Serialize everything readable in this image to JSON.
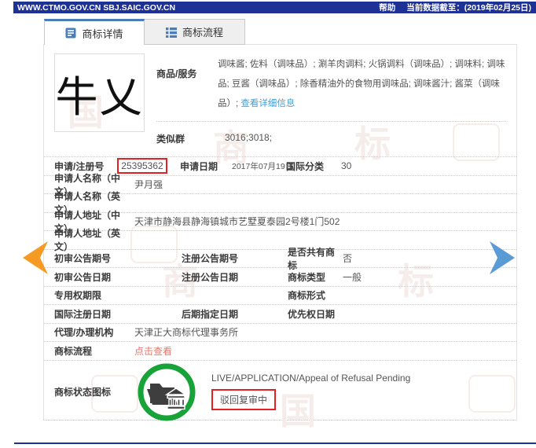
{
  "topbar": {
    "urls": "WWW.CTMO.GOV.CN SBJ.SAIC.GOV.CN",
    "help": "帮助",
    "cutoff": "当前数据截至：(2019年02月25日)"
  },
  "tabs": {
    "detail": "商标详情",
    "process": "商标流程"
  },
  "mark": {
    "text": "牛乂"
  },
  "goods": {
    "label": "商品/服务",
    "text": "调味酱; 佐料（调味品）; 涮羊肉调料; 火锅调料（调味品）; 调味料; 调味品; 豆酱（调味品）; 除香精油外的食物用调味品; 调味酱汁; 酱菜（调味品）; ",
    "link": "查看详细信息"
  },
  "similar": {
    "label": "类似群",
    "value": "3016;3018;"
  },
  "app_row": {
    "reg_label": "申请/注册号",
    "reg_value": "25395362",
    "date_label": "申请日期",
    "date_value": "2017年07月19日",
    "class_label": "国际分类",
    "class_value": "30"
  },
  "name_rows": [
    {
      "label": "申请人名称（中文）",
      "value": "尹月强"
    },
    {
      "label": "申请人名称（英文）",
      "value": ""
    },
    {
      "label": "申请人地址（中文）",
      "value": "天津市静海县静海镇城市艺墅夏泰园2号楼1门502"
    },
    {
      "label": "申请人地址（英文）",
      "value": ""
    }
  ],
  "triple_rows": [
    {
      "c1": "初审公告期号",
      "c2": "注册公告期号",
      "c3": "是否共有商标",
      "v3": "否"
    },
    {
      "c1": "初审公告日期",
      "c2": "注册公告日期",
      "c3": "商标类型",
      "v3": "一般"
    },
    {
      "c1": "专用权期限",
      "c2": "",
      "c3": "商标形式",
      "v3": ""
    },
    {
      "c1": "国际注册日期",
      "c2": "后期指定日期",
      "c3": "优先权日期",
      "v3": ""
    }
  ],
  "agent": {
    "label": "代理/办理机构",
    "value": "天津正大商标代理事务所"
  },
  "process": {
    "label": "商标流程",
    "link": "点击查看"
  },
  "status": {
    "label": "商标状态图标",
    "line_en": "LIVE/APPLICATION/Appeal of Refusal Pending",
    "line_cn": "驳回复审中"
  },
  "icons": {
    "tab_detail": "document-icon",
    "tab_process": "list-icon",
    "status": "folder-bank-icon",
    "prev": "chevron-left-icon",
    "next": "chevron-right-icon"
  },
  "colors": {
    "navy": "#1e3296",
    "highlight_red": "#e02222",
    "link_blue": "#3f9fd8",
    "link_red": "#e4766b",
    "arrow_orange": "#f59a23",
    "arrow_blue": "#5b9bd5",
    "icon_green": "#17a338",
    "tab_icon_blue": "#4a7ebb"
  },
  "watermark": {
    "chars": [
      "国",
      "商",
      "标",
      "商",
      "标",
      "国"
    ]
  }
}
